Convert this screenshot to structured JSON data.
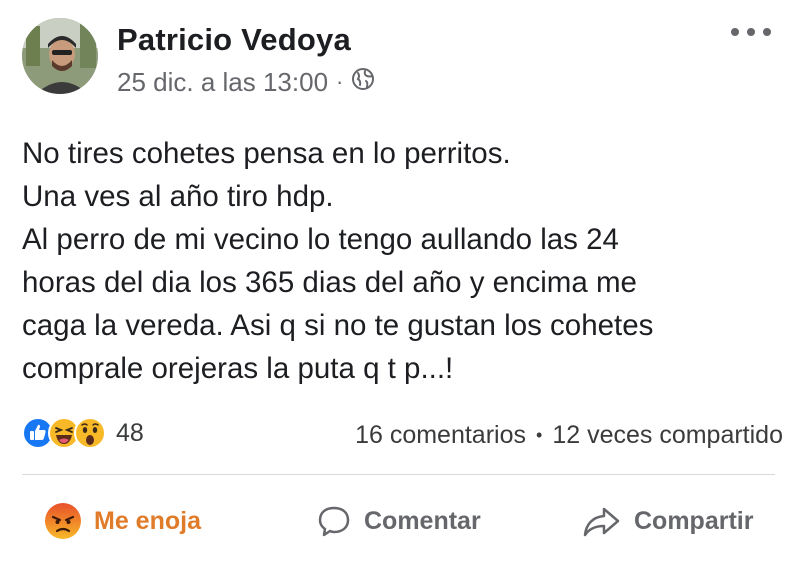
{
  "post": {
    "author": "Patricio Vedoya",
    "timestamp": "25 dic. a las 13:00",
    "separator": "·",
    "privacy_icon": "globe-icon",
    "more_icon": "more-options-icon",
    "text_lines": [
      "No tires cohetes pensa en lo perritos.",
      "Una ves al año tiro hdp.",
      "Al perro de mi vecino lo tengo aullando las 24",
      "horas del dia los 365 dias del año y encima me",
      "caga la vereda. Asi q si no te gustan los cohetes",
      "comprale orejeras la puta q t p...!"
    ]
  },
  "reactions": {
    "icons": [
      "like-reaction-icon",
      "haha-reaction-icon",
      "wow-reaction-icon"
    ],
    "count": "48",
    "comments": "16 comentarios",
    "dot": "•",
    "shares": "12 veces compartido"
  },
  "actions": {
    "angry_label": "Me enoja",
    "comment_label": "Comentar",
    "share_label": "Compartir"
  },
  "colors": {
    "like_blue": "#1877f2",
    "reaction_yellow": "#f7b928",
    "angry_orange": "#e07b2a",
    "muted_text": "#65676b"
  }
}
